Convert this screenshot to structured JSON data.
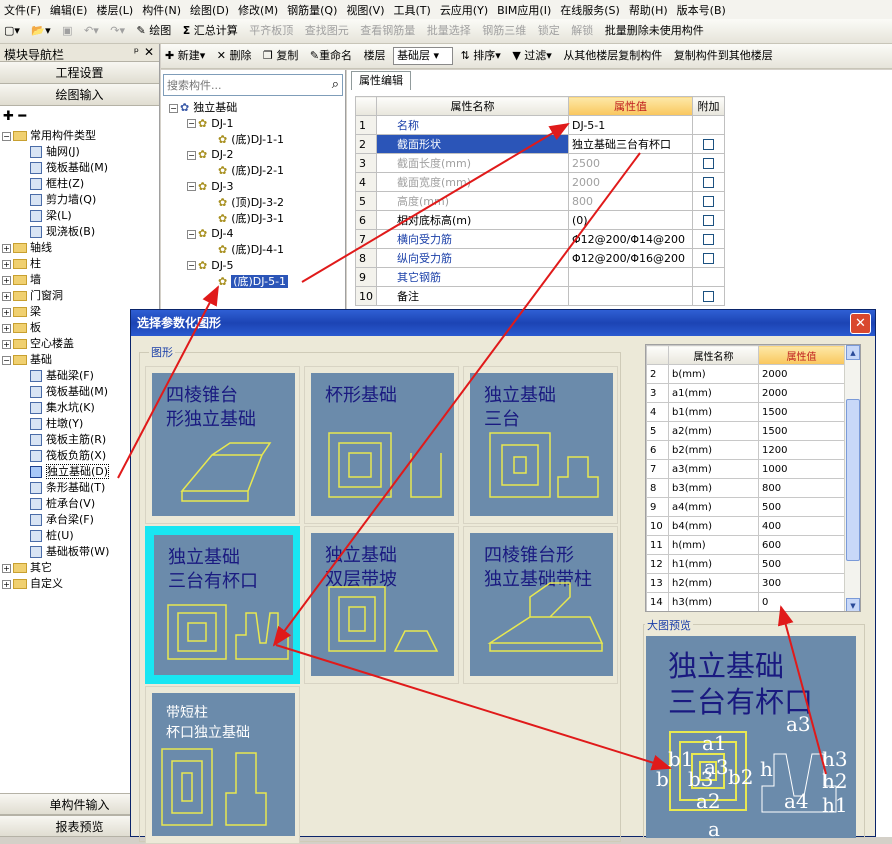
{
  "menu": [
    "文件(F)",
    "编辑(E)",
    "楼层(L)",
    "构件(N)",
    "绘图(D)",
    "修改(M)",
    "钢筋量(Q)",
    "视图(V)",
    "工具(T)",
    "云应用(Y)",
    "BIM应用(I)",
    "在线服务(S)",
    "帮助(H)",
    "版本号(B)"
  ],
  "toolbar1": {
    "draw": "绘图",
    "sum": "汇总计算",
    "flat": "平齐板顶",
    "find": "查找图元",
    "view_rebar": "查看钢筋量",
    "batch_select": "批量选择",
    "rebar3d": "钢筋三维",
    "lock": "锁定",
    "unlock": "解锁",
    "batch_delete": "批量删除未使用构件"
  },
  "nav": {
    "title": "模块导航栏",
    "pin": "ᵖ",
    "close": "✕",
    "project_settings": "工程设置",
    "draw_input": "绘图输入",
    "tools": "✚ ━",
    "single_input": "单构件输入",
    "report_preview": "报表预览",
    "tree": [
      {
        "level": 0,
        "exp": "−",
        "folder": true,
        "label": "常用构件类型"
      },
      {
        "level": 1,
        "label": "轴网(J)"
      },
      {
        "level": 1,
        "label": "筏板基础(M)"
      },
      {
        "level": 1,
        "label": "框柱(Z)"
      },
      {
        "level": 1,
        "label": "剪力墙(Q)"
      },
      {
        "level": 1,
        "label": "梁(L)"
      },
      {
        "level": 1,
        "label": "现浇板(B)"
      },
      {
        "level": 0,
        "exp": "+",
        "folder": true,
        "label": "轴线"
      },
      {
        "level": 0,
        "exp": "+",
        "folder": true,
        "label": "柱"
      },
      {
        "level": 0,
        "exp": "+",
        "folder": true,
        "label": "墙"
      },
      {
        "level": 0,
        "exp": "+",
        "folder": true,
        "label": "门窗洞"
      },
      {
        "level": 0,
        "exp": "+",
        "folder": true,
        "label": "梁"
      },
      {
        "level": 0,
        "exp": "+",
        "folder": true,
        "label": "板"
      },
      {
        "level": 0,
        "exp": "+",
        "folder": true,
        "label": "空心楼盖"
      },
      {
        "level": 0,
        "exp": "−",
        "folder": true,
        "label": "基础"
      },
      {
        "level": 1,
        "label": "基础梁(F)"
      },
      {
        "level": 1,
        "label": "筏板基础(M)"
      },
      {
        "level": 1,
        "label": "集水坑(K)"
      },
      {
        "level": 1,
        "label": "柱墩(Y)"
      },
      {
        "level": 1,
        "label": "筏板主筋(R)"
      },
      {
        "level": 1,
        "label": "筏板负筋(X)"
      },
      {
        "level": 1,
        "label": "独立基础(D)",
        "selected": true
      },
      {
        "level": 1,
        "label": "条形基础(T)"
      },
      {
        "level": 1,
        "label": "桩承台(V)"
      },
      {
        "level": 1,
        "label": "承台梁(F)"
      },
      {
        "level": 1,
        "label": "桩(U)"
      },
      {
        "level": 1,
        "label": "基础板带(W)"
      },
      {
        "level": 0,
        "exp": "+",
        "folder": true,
        "label": "其它"
      },
      {
        "level": 0,
        "exp": "+",
        "folder": true,
        "label": "自定义"
      }
    ]
  },
  "toolbar2": {
    "new": "新建",
    "delete": "删除",
    "copy": "复制",
    "rename": "重命名",
    "floor_label": "楼层",
    "floor_value": "基础层",
    "sort": "排序",
    "filter": "过滤",
    "copy_from": "从其他楼层复制构件",
    "copy_to": "复制构件到其他楼层"
  },
  "components": {
    "search_placeholder": "搜索构件...",
    "tree": [
      {
        "level": 0,
        "label": "独立基础",
        "exp": "−"
      },
      {
        "level": 1,
        "label": "DJ-1",
        "exp": "−"
      },
      {
        "level": 2,
        "label": "(底)DJ-1-1"
      },
      {
        "level": 1,
        "label": "DJ-2",
        "exp": "−"
      },
      {
        "level": 2,
        "label": "(底)DJ-2-1"
      },
      {
        "level": 1,
        "label": "DJ-3",
        "exp": "−"
      },
      {
        "level": 2,
        "label": "(顶)DJ-3-2"
      },
      {
        "level": 2,
        "label": "(底)DJ-3-1"
      },
      {
        "level": 1,
        "label": "DJ-4",
        "exp": "−"
      },
      {
        "level": 2,
        "label": "(底)DJ-4-1"
      },
      {
        "level": 1,
        "label": "DJ-5",
        "exp": "−"
      },
      {
        "level": 2,
        "label": "(底)DJ-5-1",
        "selected": true
      }
    ]
  },
  "props": {
    "tab": "属性编辑",
    "headers": {
      "name": "属性名称",
      "value": "属性值",
      "extra": "附加"
    },
    "rows": [
      {
        "n": "1",
        "name": "名称",
        "value": "DJ-5-1",
        "style": "blue",
        "cb": false
      },
      {
        "n": "2",
        "name": "截面形状",
        "value": "独立基础三台有杯口",
        "style": "hl",
        "cb": true
      },
      {
        "n": "3",
        "name": "截面长度(mm)",
        "value": "2500",
        "style": "grey",
        "cb": true
      },
      {
        "n": "4",
        "name": "截面宽度(mm)",
        "value": "2000",
        "style": "grey",
        "cb": true
      },
      {
        "n": "5",
        "name": "高度(mm)",
        "value": "800",
        "style": "grey",
        "cb": true
      },
      {
        "n": "6",
        "name": "相对底标高(m)",
        "value": "(0)",
        "style": "plain",
        "cb": true
      },
      {
        "n": "7",
        "name": "横向受力筋",
        "value": "Φ12@200/Φ14@200",
        "style": "blue",
        "cb": true
      },
      {
        "n": "8",
        "name": "纵向受力筋",
        "value": "Φ12@200/Φ16@200",
        "style": "blue",
        "cb": true
      },
      {
        "n": "9",
        "name": "其它钢筋",
        "value": "",
        "style": "blue",
        "cb": false
      },
      {
        "n": "10",
        "name": "备注",
        "value": "",
        "style": "plain",
        "cb": true
      }
    ]
  },
  "dialog": {
    "title": "选择参数化图形",
    "close": "✕",
    "shape_group": "图形",
    "preview_label": "大图预览",
    "tiles": [
      {
        "t1": "四棱锥台",
        "t2": "形独立基础"
      },
      {
        "t1": "杯形基础",
        "t2": ""
      },
      {
        "t1": "独立基础",
        "t2": "三台"
      },
      {
        "t1": "独立基础",
        "t2": "三台有杯口",
        "selected": true
      },
      {
        "t1": "独立基础",
        "t2": "双层带坡"
      },
      {
        "t1": "四棱锥台形",
        "t2": "独立基础带柱"
      },
      {
        "t1": "带短柱",
        "t2": "杯口独立基础"
      }
    ],
    "param_headers": {
      "name": "属性名称",
      "value": "属性值"
    },
    "params": [
      {
        "n": "2",
        "name": "b(mm)",
        "value": "2000"
      },
      {
        "n": "3",
        "name": "a1(mm)",
        "value": "2000"
      },
      {
        "n": "4",
        "name": "b1(mm)",
        "value": "1500"
      },
      {
        "n": "5",
        "name": "a2(mm)",
        "value": "1500"
      },
      {
        "n": "6",
        "name": "b2(mm)",
        "value": "1200"
      },
      {
        "n": "7",
        "name": "a3(mm)",
        "value": "1000"
      },
      {
        "n": "8",
        "name": "b3(mm)",
        "value": "800"
      },
      {
        "n": "9",
        "name": "a4(mm)",
        "value": "500"
      },
      {
        "n": "10",
        "name": "b4(mm)",
        "value": "400"
      },
      {
        "n": "11",
        "name": "h(mm)",
        "value": "600"
      },
      {
        "n": "12",
        "name": "h1(mm)",
        "value": "500"
      },
      {
        "n": "13",
        "name": "h2(mm)",
        "value": "300"
      },
      {
        "n": "14",
        "name": "h3(mm)",
        "value": "0"
      }
    ],
    "preview": {
      "t1": "独立基础",
      "t2": "三台有杯口"
    }
  },
  "colors": {
    "dialog_title": "#1c44b4",
    "tile_bg": "#6b8bab",
    "selected_tile": "#18e6f2",
    "arrow": "#e01a1a",
    "header_value": "#f9c65d"
  }
}
